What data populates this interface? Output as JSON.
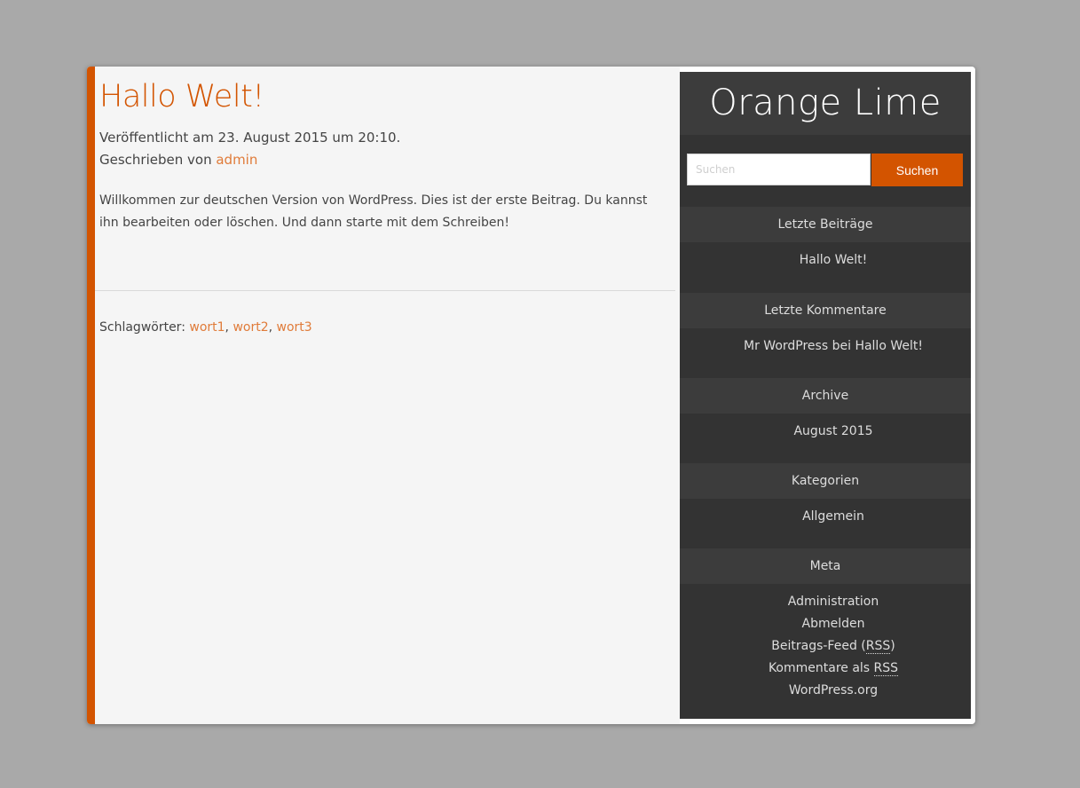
{
  "site": {
    "title": "Orange Lime"
  },
  "post": {
    "title": "Hallo Welt!",
    "published": "Veröffentlicht am 23. August 2015 um 20:10.",
    "author_prefix": "Geschrieben von",
    "author": "admin",
    "body": "Willkommen zur deutschen Version von WordPress. Dies ist der erste Beitrag. Du kannst ihn bearbeiten oder löschen. Und dann starte mit dem Schreiben!",
    "tags_label": "Schlagwörter:",
    "tags": [
      "wort1",
      "wort2",
      "wort3"
    ]
  },
  "search": {
    "placeholder": "Suchen",
    "button_label": "Suchen"
  },
  "widgets": {
    "recent_posts": {
      "title": "Letzte Beiträge",
      "items": [
        "Hallo Welt!"
      ]
    },
    "recent_comments": {
      "title": "Letzte Kommentare",
      "author": "Mr WordPress",
      "connector": "bei",
      "post": "Hallo Welt!"
    },
    "archive": {
      "title": "Archive",
      "items": [
        "August 2015"
      ]
    },
    "categories": {
      "title": "Kategorien",
      "items": [
        "Allgemein"
      ]
    },
    "meta": {
      "title": "Meta",
      "admin": "Administration",
      "logout": "Abmelden",
      "posts_feed_prefix": "Beitrags-Feed (",
      "posts_feed_abbr": "RSS",
      "posts_feed_suffix": ")",
      "comments_feed_prefix": "Kommentare als",
      "comments_feed_abbr": "RSS",
      "wordpress_org": "WordPress.org"
    }
  },
  "colors": {
    "accent": "#d35400",
    "link": "#e07b39",
    "sidebar_bg": "#333333",
    "sidebar_head_bg": "#3c3c3c",
    "content_bg": "#f5f5f5",
    "page_bg": "#a9a9a9"
  }
}
